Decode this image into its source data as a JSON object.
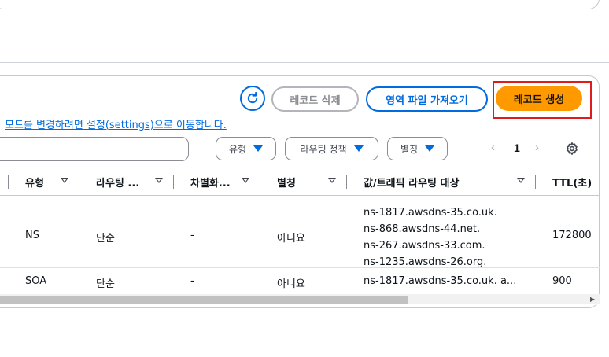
{
  "toolbar": {
    "delete_label": "레코드 삭제",
    "export_label": "영역 파일 가져오기",
    "create_label": "레코드 생성"
  },
  "info_link": "모드를 변경하려면 설정(settings)으로 이동합니다.",
  "search": {
    "value": "",
    "placeholder": ""
  },
  "filters": [
    {
      "label": "유형"
    },
    {
      "label": "라우팅 정책"
    },
    {
      "label": "별칭"
    }
  ],
  "pagination": {
    "prev": "‹",
    "current": "1",
    "next": "›"
  },
  "table": {
    "columns": [
      "유형",
      "라우팅 ...",
      "차별화...",
      "별칭",
      "값/트래픽 라우팅 대상",
      "TTL(초)"
    ],
    "rows": [
      {
        "type": "NS",
        "routing": "단순",
        "differentiator": "-",
        "alias": "아니요",
        "values": [
          "ns-1817.awsdns-35.co.uk.",
          "ns-868.awsdns-44.net.",
          "ns-267.awsdns-33.com.",
          "ns-1235.awsdns-26.org."
        ],
        "ttl": "172800"
      },
      {
        "type": "SOA",
        "routing": "단순",
        "differentiator": "-",
        "alias": "아니요",
        "values": [
          "ns-1817.awsdns-35.co.uk. a..."
        ],
        "ttl": "900"
      }
    ]
  },
  "colors": {
    "accent": "#006ce0",
    "primary_button": "#ff9900",
    "highlight_box": "#e01b1b"
  },
  "icons": [
    "refresh-icon",
    "caret-down-icon",
    "chevron-left-icon",
    "chevron-right-icon",
    "gear-icon",
    "sort-icon"
  ]
}
